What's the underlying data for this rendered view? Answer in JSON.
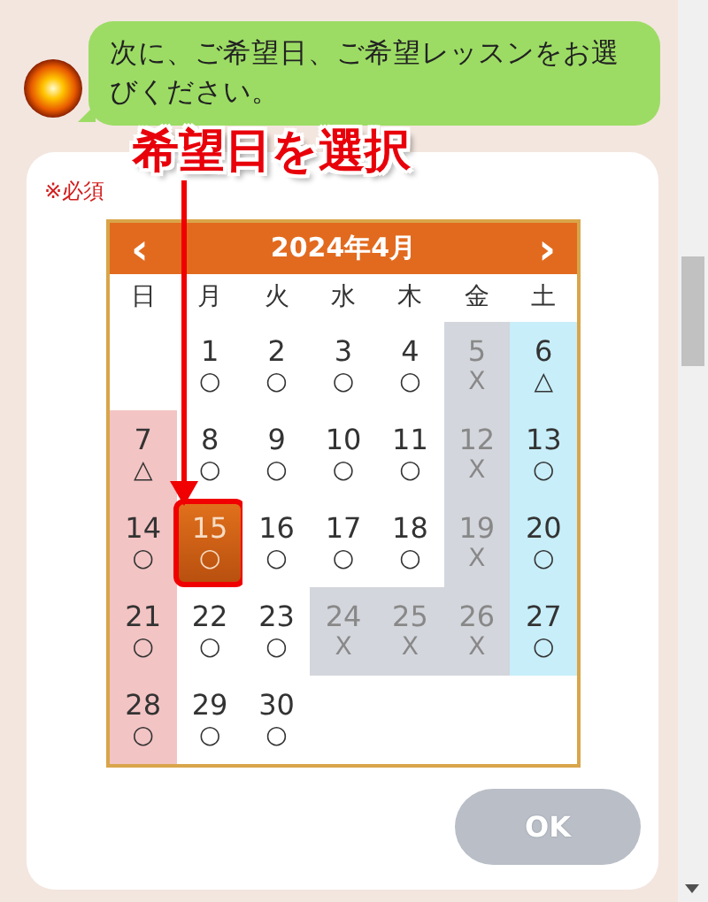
{
  "message": {
    "text": "次に、ご希望日、ご希望レッスンをお選びください。"
  },
  "annotation": {
    "label": "希望日を選択"
  },
  "form": {
    "required_label": "※必須",
    "calendar": {
      "prev": "‹",
      "title": "2024年4月",
      "next": "›",
      "weekdays": [
        "日",
        "月",
        "火",
        "水",
        "木",
        "金",
        "土"
      ],
      "weeks": [
        [
          {
            "kind": "empty"
          },
          {
            "day": "1",
            "mark": "○",
            "kind": "normal",
            "selected": false
          },
          {
            "day": "2",
            "mark": "○",
            "kind": "normal",
            "selected": false
          },
          {
            "day": "3",
            "mark": "○",
            "kind": "normal",
            "selected": false
          },
          {
            "day": "4",
            "mark": "○",
            "kind": "normal",
            "selected": false
          },
          {
            "day": "5",
            "mark": "X",
            "kind": "closed",
            "selected": false
          },
          {
            "day": "6",
            "mark": "△",
            "kind": "saturday",
            "selected": false
          }
        ],
        [
          {
            "day": "7",
            "mark": "△",
            "kind": "sunday",
            "selected": false
          },
          {
            "day": "8",
            "mark": "○",
            "kind": "normal",
            "selected": false
          },
          {
            "day": "9",
            "mark": "○",
            "kind": "normal",
            "selected": false
          },
          {
            "day": "10",
            "mark": "○",
            "kind": "normal",
            "selected": false
          },
          {
            "day": "11",
            "mark": "○",
            "kind": "normal",
            "selected": false
          },
          {
            "day": "12",
            "mark": "X",
            "kind": "closed",
            "selected": false
          },
          {
            "day": "13",
            "mark": "○",
            "kind": "saturday",
            "selected": false
          }
        ],
        [
          {
            "day": "14",
            "mark": "○",
            "kind": "sunday",
            "selected": false
          },
          {
            "day": "15",
            "mark": "○",
            "kind": "normal",
            "selected": true
          },
          {
            "day": "16",
            "mark": "○",
            "kind": "normal",
            "selected": false
          },
          {
            "day": "17",
            "mark": "○",
            "kind": "normal",
            "selected": false
          },
          {
            "day": "18",
            "mark": "○",
            "kind": "normal",
            "selected": false
          },
          {
            "day": "19",
            "mark": "X",
            "kind": "closed",
            "selected": false
          },
          {
            "day": "20",
            "mark": "○",
            "kind": "saturday",
            "selected": false
          }
        ],
        [
          {
            "day": "21",
            "mark": "○",
            "kind": "sunday",
            "selected": false
          },
          {
            "day": "22",
            "mark": "○",
            "kind": "normal",
            "selected": false
          },
          {
            "day": "23",
            "mark": "○",
            "kind": "normal",
            "selected": false
          },
          {
            "day": "24",
            "mark": "X",
            "kind": "closed",
            "selected": false
          },
          {
            "day": "25",
            "mark": "X",
            "kind": "closed",
            "selected": false
          },
          {
            "day": "26",
            "mark": "X",
            "kind": "closed",
            "selected": false
          },
          {
            "day": "27",
            "mark": "○",
            "kind": "saturday",
            "selected": false
          }
        ],
        [
          {
            "day": "28",
            "mark": "○",
            "kind": "sunday",
            "selected": false
          },
          {
            "day": "29",
            "mark": "○",
            "kind": "normal",
            "selected": false
          },
          {
            "day": "30",
            "mark": "○",
            "kind": "normal",
            "selected": false
          },
          {
            "kind": "empty"
          },
          {
            "kind": "empty"
          },
          {
            "kind": "empty"
          },
          {
            "kind": "empty"
          }
        ]
      ]
    },
    "ok_button": {
      "label": "OK",
      "disabled": true
    }
  }
}
